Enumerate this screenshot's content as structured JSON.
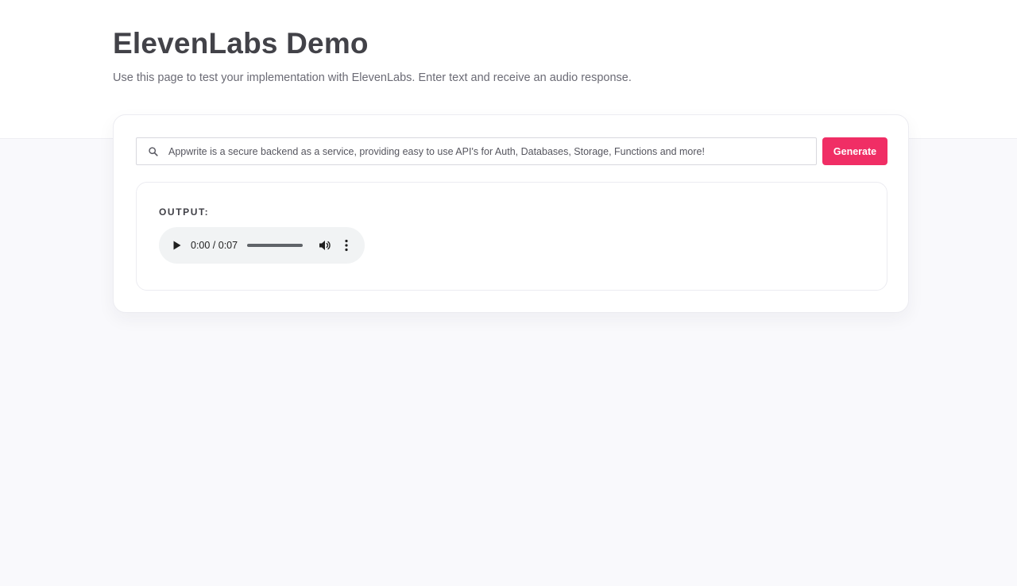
{
  "header": {
    "title": "ElevenLabs Demo",
    "subtitle": "Use this page to test your implementation with ElevenLabs. Enter text and receive an audio response."
  },
  "form": {
    "search_icon": "search-icon",
    "input_value": "Appwrite is a secure backend as a service, providing easy to use API's for Auth, Databases, Storage, Functions and more!",
    "generate_label": "Generate"
  },
  "output": {
    "label": "OUTPUT:",
    "audio": {
      "time_display": "0:00 / 0:07",
      "current_time": "0:00",
      "duration": "0:07",
      "progress": 0,
      "icons": [
        "play-icon",
        "volume-icon",
        "more-vertical-icon"
      ]
    }
  },
  "colors": {
    "accent": "#f02e65",
    "title": "#424248",
    "subtitle": "#6b6b75",
    "background": "#f9f9fc",
    "player_background": "#f1f3f4"
  }
}
